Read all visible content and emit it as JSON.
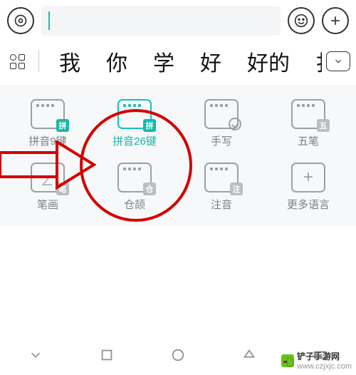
{
  "topbar": {
    "input_value": ""
  },
  "candidates": {
    "items": [
      "我",
      "你",
      "学",
      "好",
      "好的",
      "扌"
    ]
  },
  "keyboard_layouts": {
    "row1": [
      {
        "label": "拼音9键",
        "badge": "拼",
        "badge_color": "teal",
        "active": false,
        "icon": "kb9"
      },
      {
        "label": "拼音26键",
        "badge": "拼",
        "badge_color": "teal",
        "active": true,
        "icon": "kb26"
      },
      {
        "label": "手写",
        "badge": "",
        "badge_color": "",
        "active": false,
        "icon": "hand"
      },
      {
        "label": "五笔",
        "badge": "五",
        "badge_color": "gray",
        "active": false,
        "icon": "kb26"
      }
    ],
    "row2": [
      {
        "label": "笔画",
        "badge": "笔",
        "badge_color": "gray",
        "active": false,
        "icon": "stroke"
      },
      {
        "label": "仓颉",
        "badge": "仓",
        "badge_color": "gray",
        "active": false,
        "icon": "kb26"
      },
      {
        "label": "注音",
        "badge": "注",
        "badge_color": "gray",
        "active": false,
        "icon": "kb26"
      },
      {
        "label": "更多语言",
        "badge": "",
        "badge_color": "",
        "active": false,
        "icon": "plus"
      }
    ]
  },
  "watermark": {
    "name": "铲子手游网",
    "url": "www.czjxjc.com"
  },
  "annotation": {
    "circle_color": "#d40000"
  }
}
